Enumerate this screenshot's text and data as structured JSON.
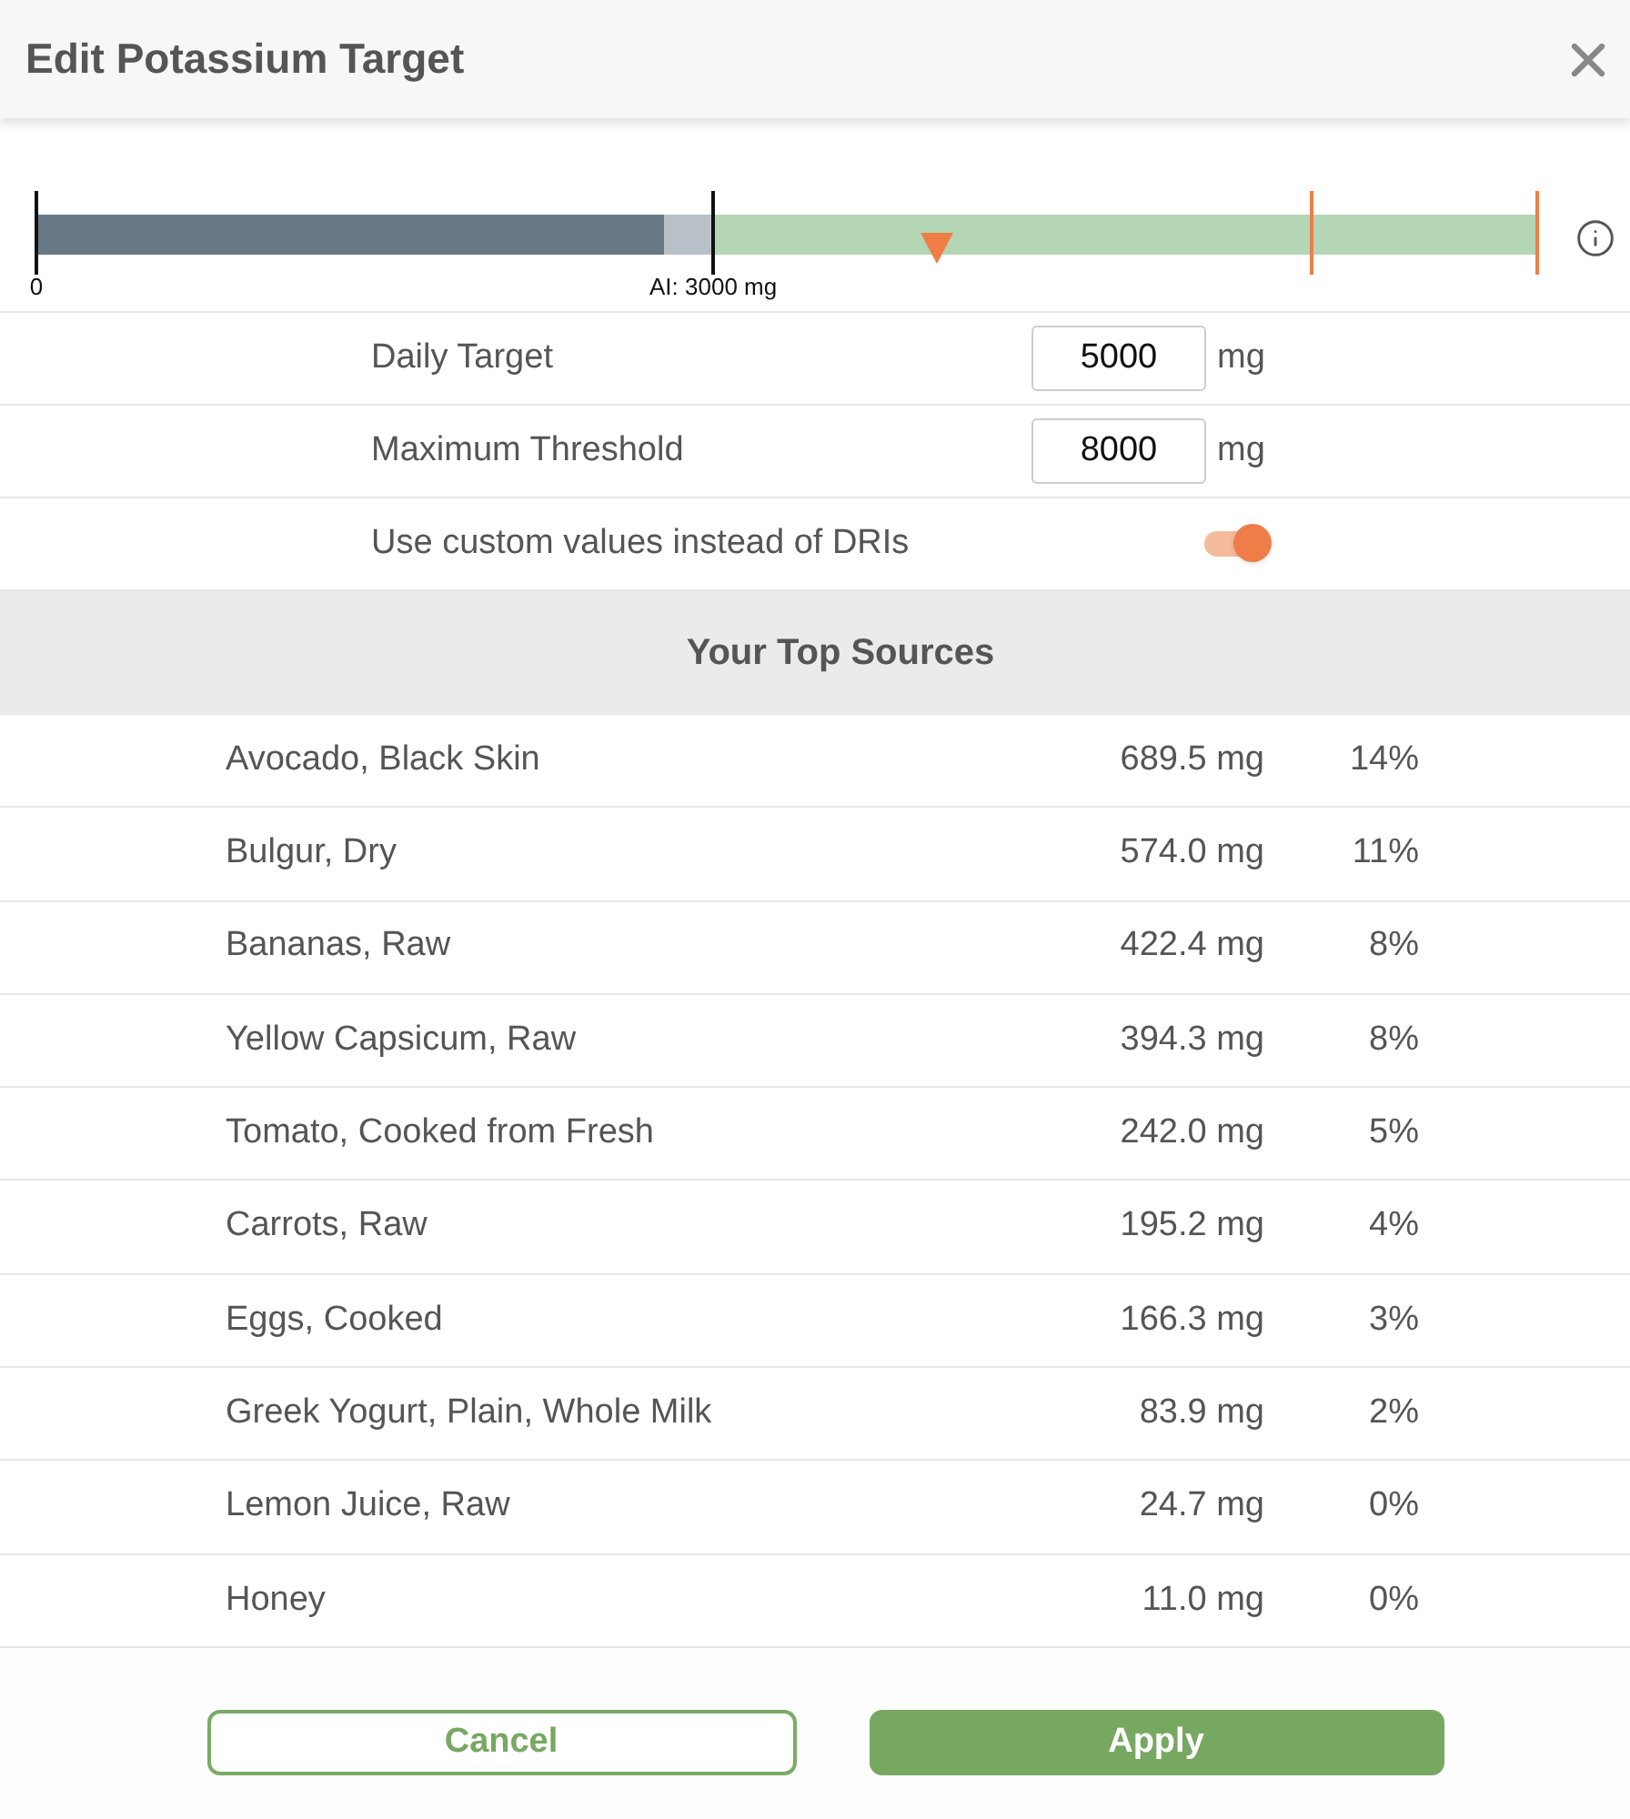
{
  "dialog": {
    "title": "Edit Potassium Target"
  },
  "meter": {
    "level": 0.418,
    "target_marker": {
      "level": 0.6
    },
    "ticks": [
      {
        "kind": "start",
        "label": "0",
        "level": 0
      },
      {
        "kind": "ai",
        "label": "AI: 3000 mg",
        "level": 0.451
      },
      {
        "kind": "target",
        "level": 0.85
      },
      {
        "kind": "max",
        "level": 1
      }
    ]
  },
  "settings": [
    {
      "kind": "number",
      "label": "Daily Target",
      "value": "5000",
      "unit": "mg"
    },
    {
      "kind": "number",
      "label": "Maximum Threshold",
      "value": "8000",
      "unit": "mg"
    },
    {
      "kind": "toggle",
      "label": "Use custom values instead of DRIs",
      "on": true
    }
  ],
  "top_sources": {
    "title": "Your Top Sources",
    "rows": [
      {
        "name": "Avocado, Black Skin",
        "amount": "689.5 mg",
        "percent": "14%"
      },
      {
        "name": "Bulgur, Dry",
        "amount": "574.0 mg",
        "percent": "11%"
      },
      {
        "name": "Bananas, Raw",
        "amount": "422.4 mg",
        "percent": "8%"
      },
      {
        "name": "Yellow Capsicum, Raw",
        "amount": "394.3 mg",
        "percent": "8%"
      },
      {
        "name": "Tomato, Cooked from Fresh",
        "amount": "242.0 mg",
        "percent": "5%"
      },
      {
        "name": "Carrots, Raw",
        "amount": "195.2 mg",
        "percent": "4%"
      },
      {
        "name": "Eggs, Cooked",
        "amount": "166.3 mg",
        "percent": "3%"
      },
      {
        "name": "Greek Yogurt, Plain, Whole Milk",
        "amount": "83.9 mg",
        "percent": "2%"
      },
      {
        "name": "Lemon Juice, Raw",
        "amount": "24.7 mg",
        "percent": "0%"
      },
      {
        "name": "Honey",
        "amount": "11.0 mg",
        "percent": "0%"
      }
    ]
  },
  "buttons": [
    {
      "kind": "secondary",
      "label": "Cancel"
    },
    {
      "kind": "primary",
      "label": "Apply"
    }
  ]
}
